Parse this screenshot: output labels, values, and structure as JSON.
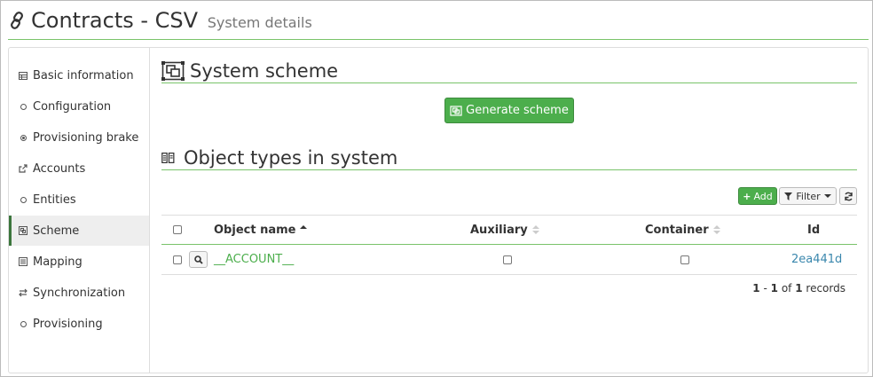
{
  "header": {
    "title": "Contracts - CSV",
    "subtitle": "System details",
    "icon": "link-icon"
  },
  "sidebar": {
    "items": [
      {
        "label": "Basic information",
        "icon": "table-icon",
        "active": false
      },
      {
        "label": "Configuration",
        "icon": "circle-icon",
        "active": false
      },
      {
        "label": "Provisioning brake",
        "icon": "dot-circle-icon",
        "active": false
      },
      {
        "label": "Accounts",
        "icon": "external-link-icon",
        "active": false
      },
      {
        "label": "Entities",
        "icon": "circle-icon",
        "active": false
      },
      {
        "label": "Scheme",
        "icon": "object-align-icon",
        "active": true
      },
      {
        "label": "Mapping",
        "icon": "list-icon",
        "active": false
      },
      {
        "label": "Synchronization",
        "icon": "transfer-icon",
        "active": false
      },
      {
        "label": "Provisioning",
        "icon": "circle-icon",
        "active": false
      }
    ]
  },
  "scheme": {
    "title": "System scheme",
    "generate_label": "Generate scheme"
  },
  "objects": {
    "title": "Object types in system",
    "add_label": "Add",
    "filter_label": "Filter",
    "columns": {
      "name": "Object name",
      "auxiliary": "Auxiliary",
      "container": "Container",
      "id": "Id"
    },
    "rows": [
      {
        "name": "__ACCOUNT__",
        "auxiliary": false,
        "container": false,
        "id": "2ea441d"
      }
    ],
    "pager": {
      "from": "1",
      "dash": "-",
      "to": "1",
      "of": "of",
      "total": "1",
      "records": "records"
    }
  },
  "colors": {
    "accent": "#4cae4c",
    "link": "#3a87ad",
    "divider": "#79c36a"
  }
}
